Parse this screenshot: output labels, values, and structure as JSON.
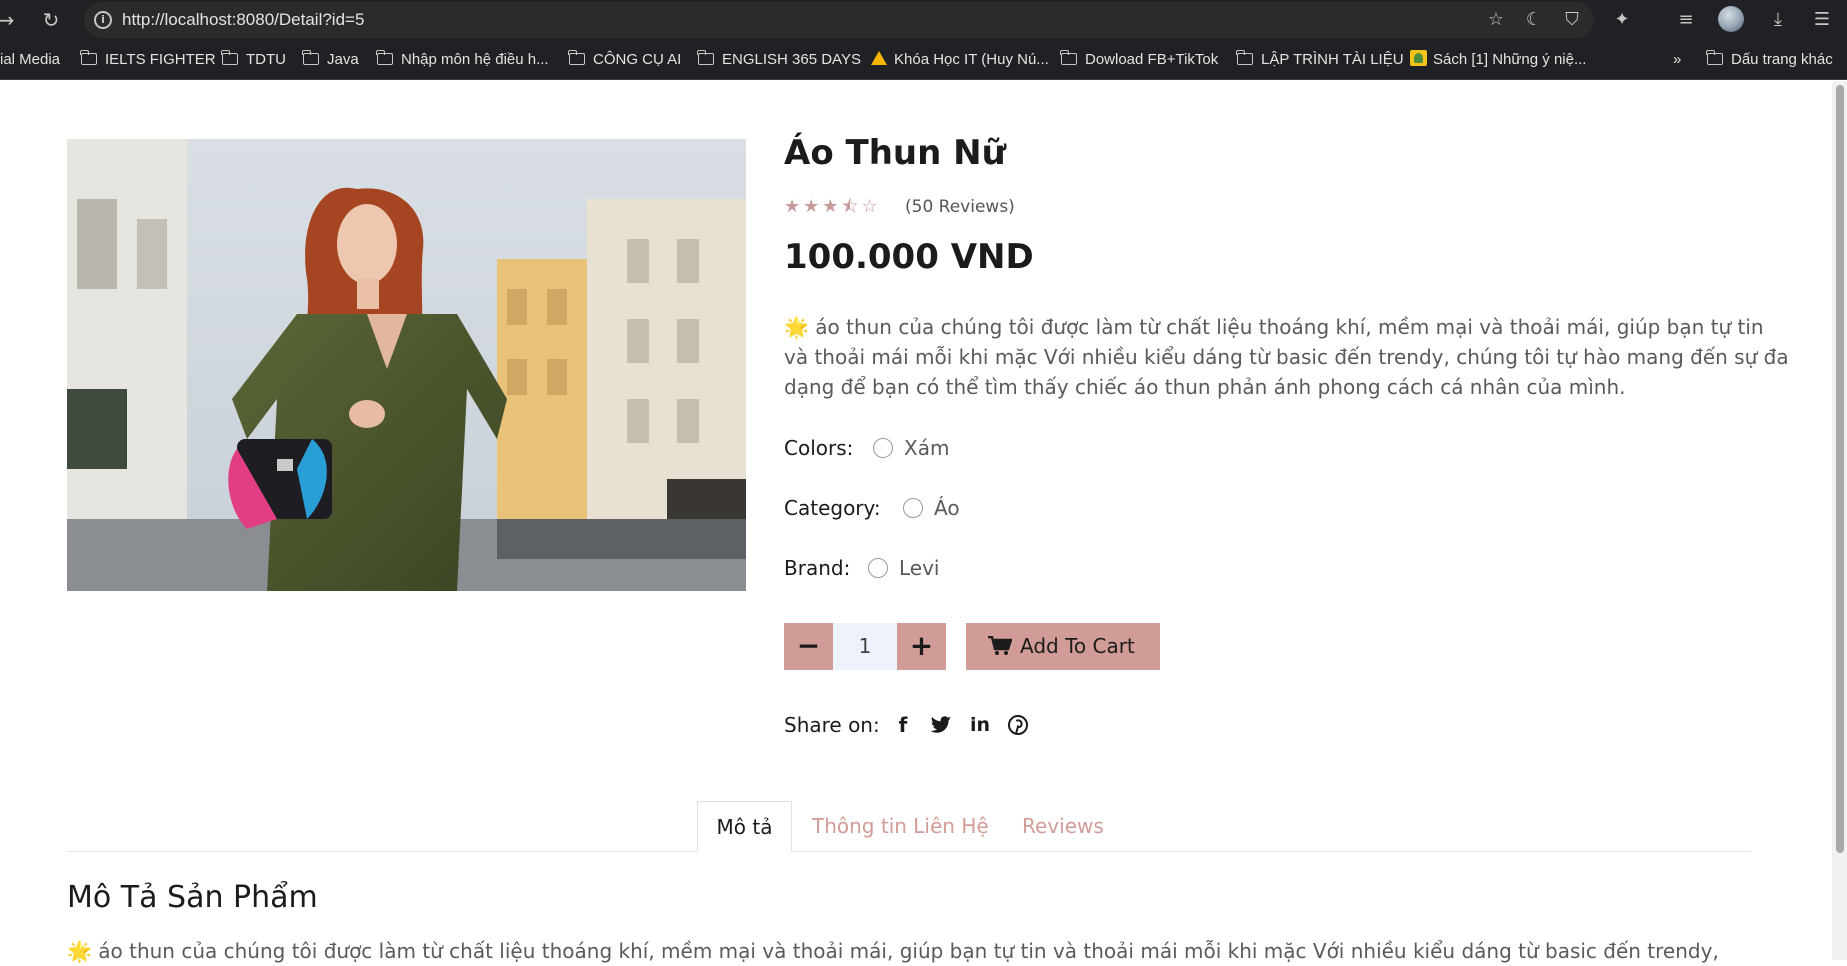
{
  "browser": {
    "url": "http://localhost:8080/Detail?id=5",
    "bookmarks": [
      {
        "label": "ial Media",
        "icon": "none"
      },
      {
        "label": "IELTS FIGHTER",
        "icon": "folder-icon"
      },
      {
        "label": "TDTU",
        "icon": "folder-icon"
      },
      {
        "label": "Java",
        "icon": "folder-icon"
      },
      {
        "label": "Nhập môn hệ điều h...",
        "icon": "folder-icon"
      },
      {
        "label": "CÔNG CỤ AI",
        "icon": "folder-icon"
      },
      {
        "label": "ENGLISH 365 DAYS",
        "icon": "folder-icon"
      },
      {
        "label": "Khóa Học IT (Huy Nú...",
        "icon": "google-drive-icon"
      },
      {
        "label": "Dowload FB+TikTok",
        "icon": "folder-icon"
      },
      {
        "label": "LẬP TRÌNH TÀI LIỆU",
        "icon": "folder-icon"
      },
      {
        "label": "Sách [1] Những ý niệ...",
        "icon": "sheet-icon"
      }
    ],
    "more_bookmarks": "»",
    "other_bookmarks": "Dấu trang khác"
  },
  "product": {
    "title": "Áo Thun Nữ",
    "rating": 3.5,
    "rating_max": 5,
    "reviews": "(50 Reviews)",
    "price": "100.000 VND",
    "description_emoji": "🌟",
    "description": "áo thun của chúng tôi được làm từ chất liệu thoáng khí, mềm mại và thoải mái, giúp bạn tự tin và thoải mái mỗi khi mặc Với nhiều kiểu dáng từ basic đến trendy, chúng tôi tự hào mang đến sự đa dạng để bạn có thể tìm thấy chiếc áo thun phản ánh phong cách cá nhân của mình.",
    "options": {
      "colors_label": "Colors:",
      "colors_value": "Xám",
      "category_label": "Category:",
      "category_value": "Áo",
      "brand_label": "Brand:",
      "brand_value": "Levi"
    },
    "quantity": "1",
    "minus_label": "−",
    "plus_label": "+",
    "add_to_cart": "Add To Cart",
    "share_label": "Share on:",
    "social": {
      "facebook": "f",
      "twitter": "t",
      "linkedin": "in",
      "pinterest": "p"
    }
  },
  "tabs": [
    "Mô tả",
    "Thông tin Liên Hệ",
    "Reviews"
  ],
  "section": {
    "title": "Mô Tả Sản Phẩm",
    "text": "áo thun của chúng tôi được làm từ chất liệu thoáng khí, mềm mại và thoải mái, giúp bạn tự tin và thoải mái mỗi khi mặc Với nhiều kiểu dáng từ basic đến trendy,"
  },
  "colors": {
    "accent": "#d19c97",
    "qty_bg": "#eef3fb",
    "chrome": "#202124"
  }
}
